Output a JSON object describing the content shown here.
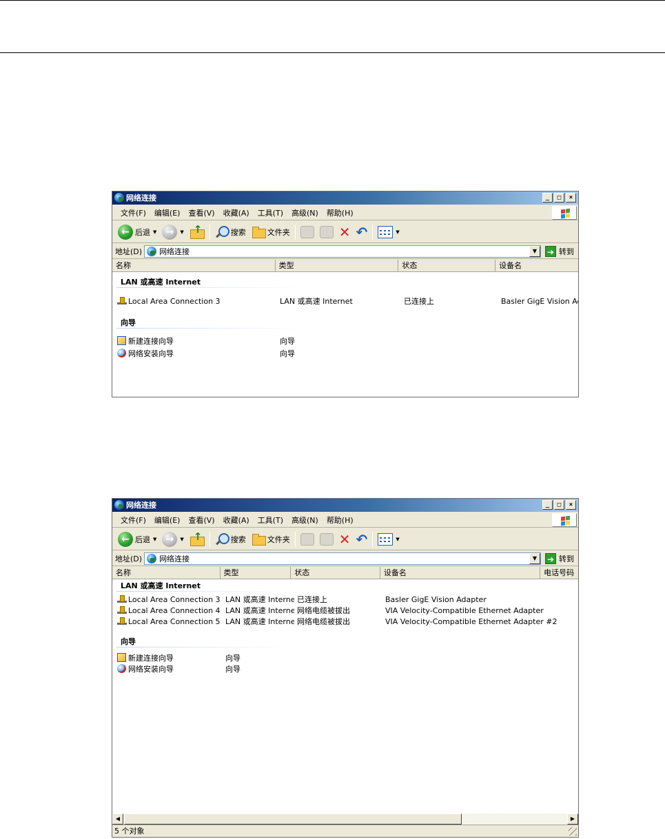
{
  "window_title": "网络连接",
  "menu": [
    "文件(F)",
    "编辑(E)",
    "查看(V)",
    "收藏(A)",
    "工具(T)",
    "高级(N)",
    "帮助(H)"
  ],
  "toolbar": {
    "back_label": "后退",
    "search_label": "搜索",
    "folders_label": "文件夹"
  },
  "address": {
    "label": "地址(D)",
    "value": "网络连接",
    "go_label": "转到"
  },
  "window1": {
    "columns": [
      "名称",
      "类型",
      "状态",
      "设备名"
    ],
    "group_lan": "LAN 或高速 Internet",
    "group_wizard": "向导",
    "rows": [
      {
        "name": "Local Area Connection 3",
        "type": "LAN 或高速 Internet",
        "status": "已连接上",
        "device": "Basler GigE Vision Adap"
      }
    ],
    "wizards": [
      {
        "name": "新建连接向导",
        "type": "向导"
      },
      {
        "name": "网络安装向导",
        "type": "向导"
      }
    ]
  },
  "window2": {
    "columns": [
      "名称",
      "类型",
      "状态",
      "设备名",
      "电话号码"
    ],
    "group_lan": "LAN 或高速 Internet",
    "group_wizard": "向导",
    "rows": [
      {
        "name": "Local Area Connection 3",
        "type": "LAN 或高速 Internet",
        "status": "已连接上",
        "device": "Basler GigE Vision Adapter"
      },
      {
        "name": "Local Area Connection 4",
        "type": "LAN 或高速 Internet",
        "status": "网络电缆被拔出",
        "device": "VIA Velocity-Compatible Ethernet Adapter"
      },
      {
        "name": "Local Area Connection 5",
        "type": "LAN 或高速 Internet",
        "status": "网络电缆被拔出",
        "device": "VIA Velocity-Compatible Ethernet Adapter #2"
      }
    ],
    "wizards": [
      {
        "name": "新建连接向导",
        "type": "向导"
      },
      {
        "name": "网络安装向导",
        "type": "向导"
      }
    ],
    "status_text": "5 个对象"
  }
}
